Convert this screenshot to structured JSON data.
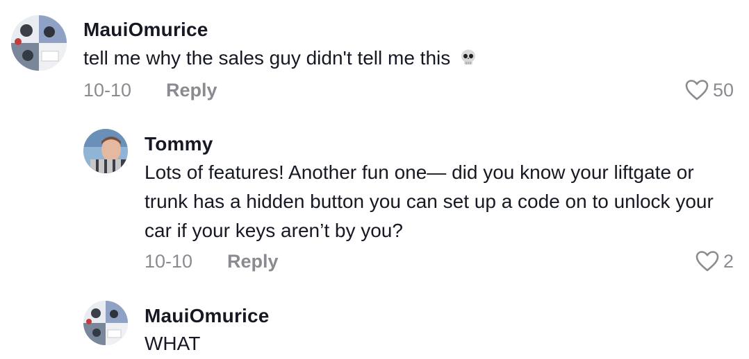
{
  "comments": [
    {
      "username": "MauiOmurice",
      "text": "tell me why the sales guy didn't tell me this",
      "emoji": "skull-emoji",
      "date": "10-10",
      "reply_label": "Reply",
      "likes": "50"
    },
    {
      "username": "Tommy",
      "text": "Lots of features! Another fun one— did you know your liftgate or trunk has a hidden button you can set up a code on to unlock your car if your keys aren’t by you?",
      "date": "10-10",
      "reply_label": "Reply",
      "likes": "2"
    },
    {
      "username": "MauiOmurice",
      "text": "WHAT"
    }
  ],
  "icons": {
    "like": "heart-outline-icon"
  },
  "colors": {
    "text": "#161823",
    "muted": "#8a8b91"
  }
}
